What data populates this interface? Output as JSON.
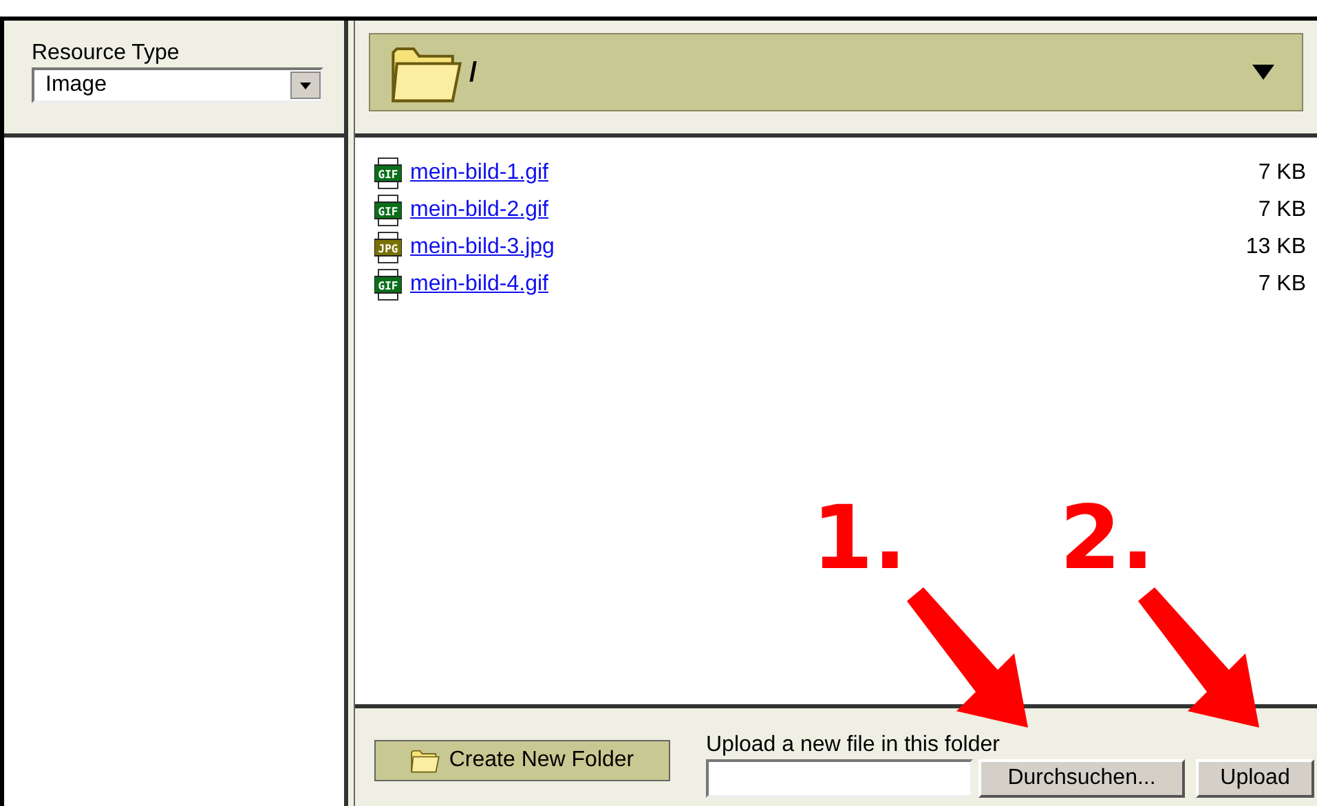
{
  "resource_type": {
    "label": "Resource Type",
    "value": "Image"
  },
  "folder_bar": {
    "path": "/"
  },
  "files": [
    {
      "name": "mein-bild-1.gif",
      "size": "7 KB",
      "kind": "gif",
      "icon_text": "GIF"
    },
    {
      "name": "mein-bild-2.gif",
      "size": "7 KB",
      "kind": "gif",
      "icon_text": "GIF"
    },
    {
      "name": "mein-bild-3.jpg",
      "size": "13 KB",
      "kind": "jpg",
      "icon_text": "JPG"
    },
    {
      "name": "mein-bild-4.gif",
      "size": "7 KB",
      "kind": "gif",
      "icon_text": "GIF"
    }
  ],
  "bottom_bar": {
    "create_folder": "Create New Folder",
    "upload_label": "Upload a new file in this folder",
    "browse": "Durchsuchen...",
    "upload": "Upload"
  },
  "annotations": [
    {
      "text": "1."
    },
    {
      "text": "2."
    }
  ]
}
